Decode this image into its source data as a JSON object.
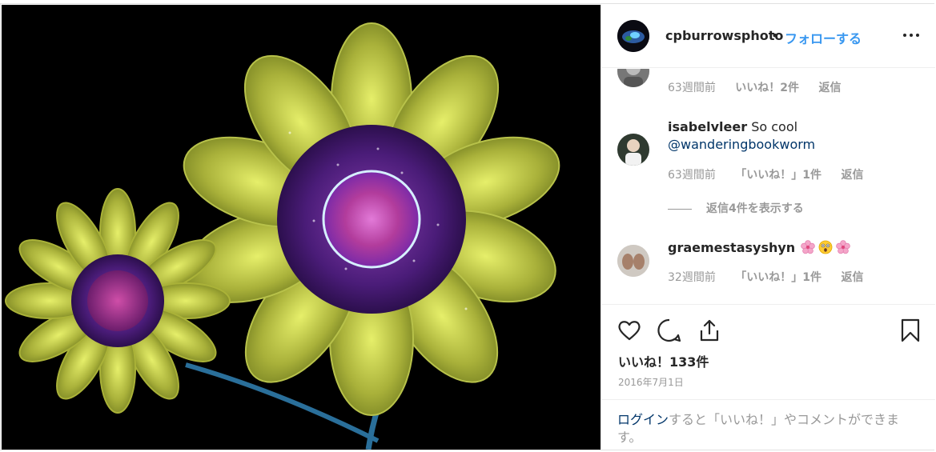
{
  "header": {
    "username": "cpburrowsphoto",
    "separator": "•",
    "follow_label": "フォローする"
  },
  "comments": [
    {
      "author": "",
      "text": "",
      "time": "63週間前",
      "likes": "いいね！2件",
      "reply": "返信"
    },
    {
      "author": "isabelvleer",
      "text": "So cool",
      "mention": "@wanderingbookworm",
      "time": "63週間前",
      "likes": "「いいね！」1件",
      "reply": "返信",
      "view_replies": "返信4件を表示する"
    },
    {
      "author": "graemestasyshyn",
      "emojis": [
        "cherry-blossom",
        "astonished-face",
        "cherry-blossom"
      ],
      "time": "32週間前",
      "likes": "「いいね！」1件",
      "reply": "返信"
    }
  ],
  "post": {
    "likes": "いいね！133件",
    "date": "2016年7月1日"
  },
  "login": {
    "link": "ログイン",
    "rest": "すると「いいね！」やコメントができます。"
  },
  "colors": {
    "accent": "#3897f0",
    "link": "#003569",
    "muted": "#999999",
    "text": "#262626"
  }
}
